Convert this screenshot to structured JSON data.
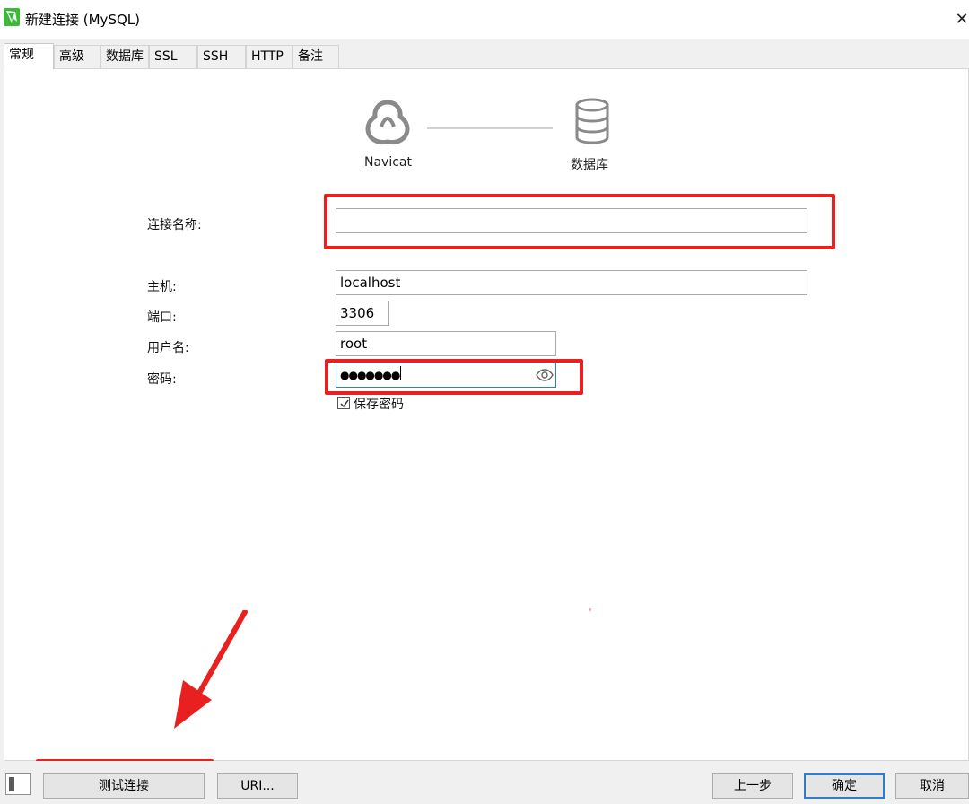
{
  "window": {
    "title": "新建连接 (MySQL)",
    "close_glyph": "✕",
    "icon": "navicat-app-icon"
  },
  "tabs": [
    {
      "label": "常规",
      "active": true
    },
    {
      "label": "高级",
      "active": false
    },
    {
      "label": "数据库",
      "active": false
    },
    {
      "label": "SSL",
      "active": false
    },
    {
      "label": "SSH",
      "active": false
    },
    {
      "label": "HTTP",
      "active": false
    },
    {
      "label": "备注",
      "active": false
    }
  ],
  "diagram": {
    "left_caption": "Navicat",
    "right_caption": "数据库",
    "left_icon": "navicat-logo-icon",
    "right_icon": "database-icon"
  },
  "form": {
    "connection_name": {
      "label": "连接名称:",
      "value": ""
    },
    "host": {
      "label": "主机:",
      "value": "localhost"
    },
    "port": {
      "label": "端口:",
      "value": "3306"
    },
    "username": {
      "label": "用户名:",
      "value": "root"
    },
    "password": {
      "label": "密码:",
      "value": "●●●●●●●"
    },
    "save_password": {
      "label": "保存密码",
      "checked": true
    }
  },
  "buttons": {
    "test_connection": "测试连接",
    "uri": "URI...",
    "back": "上一步",
    "ok": "确定",
    "cancel": "取消"
  },
  "colors": {
    "highlight": "#e8201f",
    "focus": "#2d7dd2",
    "app_icon": "#3db83d"
  }
}
